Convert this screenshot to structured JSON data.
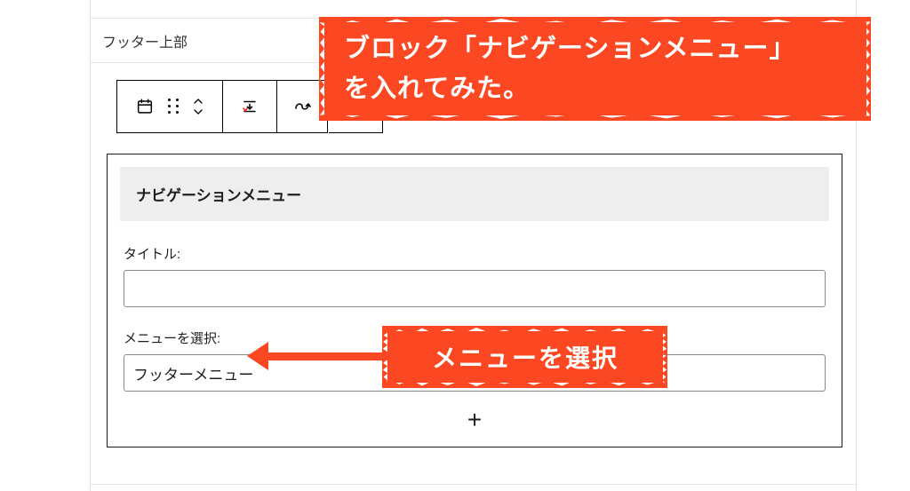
{
  "section_title": "フッター上部",
  "annotation_top": {
    "line1": "ブロック「ナビゲーションメニュー」",
    "line2": "を入れてみた。"
  },
  "annotation_mid": "メニューを選択",
  "toolbar": {
    "icons": {
      "block_type": "legacy-widget-icon",
      "drag": "drag-handle-icon",
      "move_up": "move-up-icon",
      "move_down": "move-down-icon",
      "transform": "move-to-widget-area-icon",
      "options": "options-icon"
    }
  },
  "widget": {
    "header": "ナビゲーションメニュー",
    "title_label": "タイトル:",
    "title_value": "",
    "menu_label": "メニューを選択:",
    "menu_selected": "フッターメニュー"
  },
  "add_block_label": "+"
}
